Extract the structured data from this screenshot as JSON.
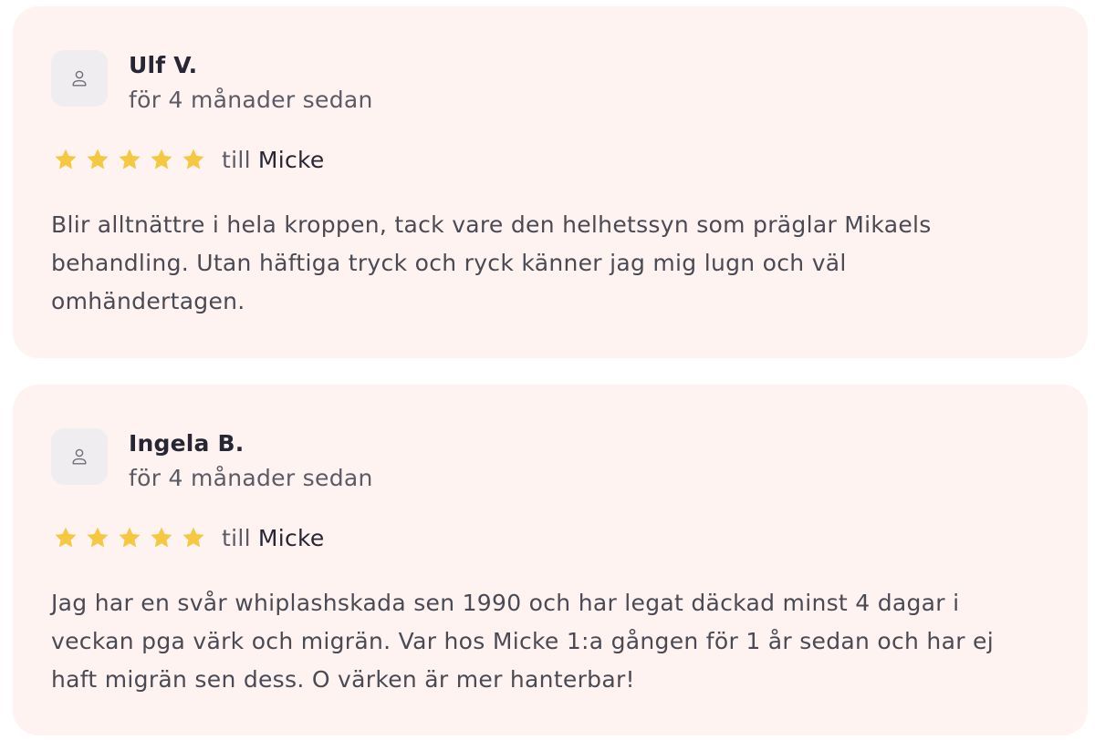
{
  "reviews": [
    {
      "author": "Ulf V.",
      "date": "för 4 månader sedan",
      "rating": 5,
      "rating_max": 5,
      "to_label": "till",
      "practitioner": "Micke",
      "text": "Blir alltnättre i hela kroppen, tack vare den helhetssyn som präglar Mikaels behandling. Utan häftiga tryck och ryck känner jag mig lugn och väl omhändertagen.",
      "avatar_icon": "user-icon"
    },
    {
      "author": "Ingela B.",
      "date": "för 4 månader sedan",
      "rating": 5,
      "rating_max": 5,
      "to_label": "till",
      "practitioner": "Micke",
      "text": "Jag har en svår whiplashskada sen 1990 och har legat däckad minst 4 dagar i veckan pga värk och migrän. Var hos Micke 1:a gången för 1 år sedan och har ej haft migrän sen dess. O värken är mer hanterbar!",
      "avatar_icon": "user-icon"
    }
  ],
  "colors": {
    "card_background": "#fef3f1",
    "star": "#f5c842",
    "avatar_background": "#efedef",
    "name_text": "#262634",
    "body_text": "#4a4a55"
  }
}
